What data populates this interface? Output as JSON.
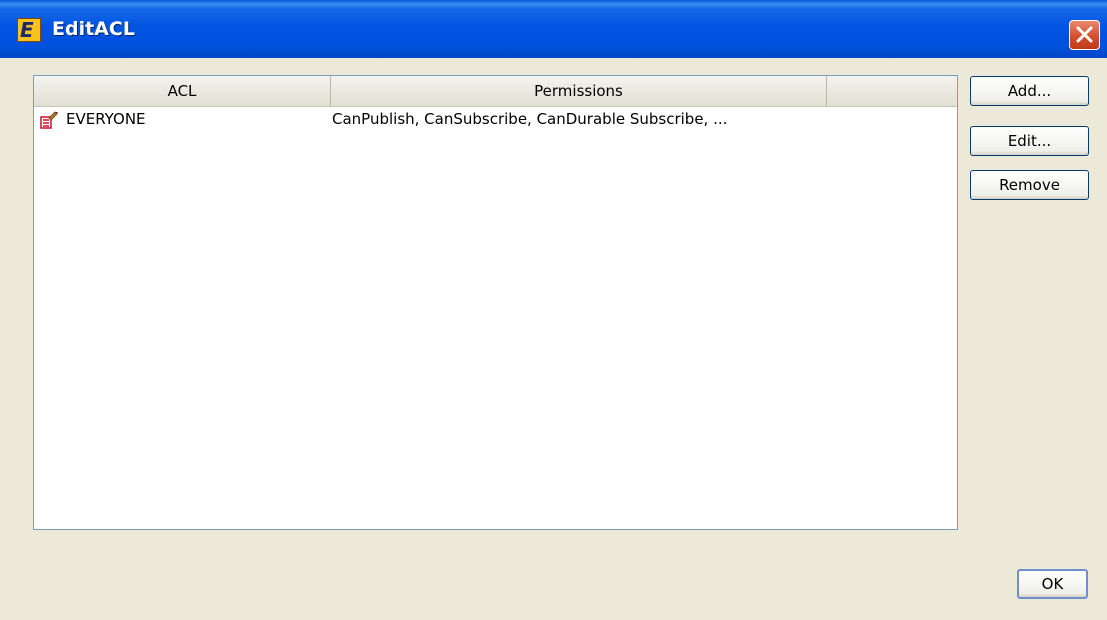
{
  "window": {
    "title": "EditACL",
    "app_icon_letter": "E"
  },
  "table": {
    "columns": [
      "ACL",
      "Permissions",
      ""
    ],
    "rows": [
      {
        "acl": "EVERYONE",
        "permissions": "CanPublish, CanSubscribe, CanDurable Subscribe, ..."
      }
    ]
  },
  "buttons": {
    "add": "Add...",
    "edit": "Edit...",
    "remove": "Remove",
    "ok": "OK"
  },
  "colors": {
    "titlebar": "#0054e3",
    "dialog_bg": "#ece9d8",
    "close_button": "#d3502f",
    "table_border": "#7f9db9"
  }
}
